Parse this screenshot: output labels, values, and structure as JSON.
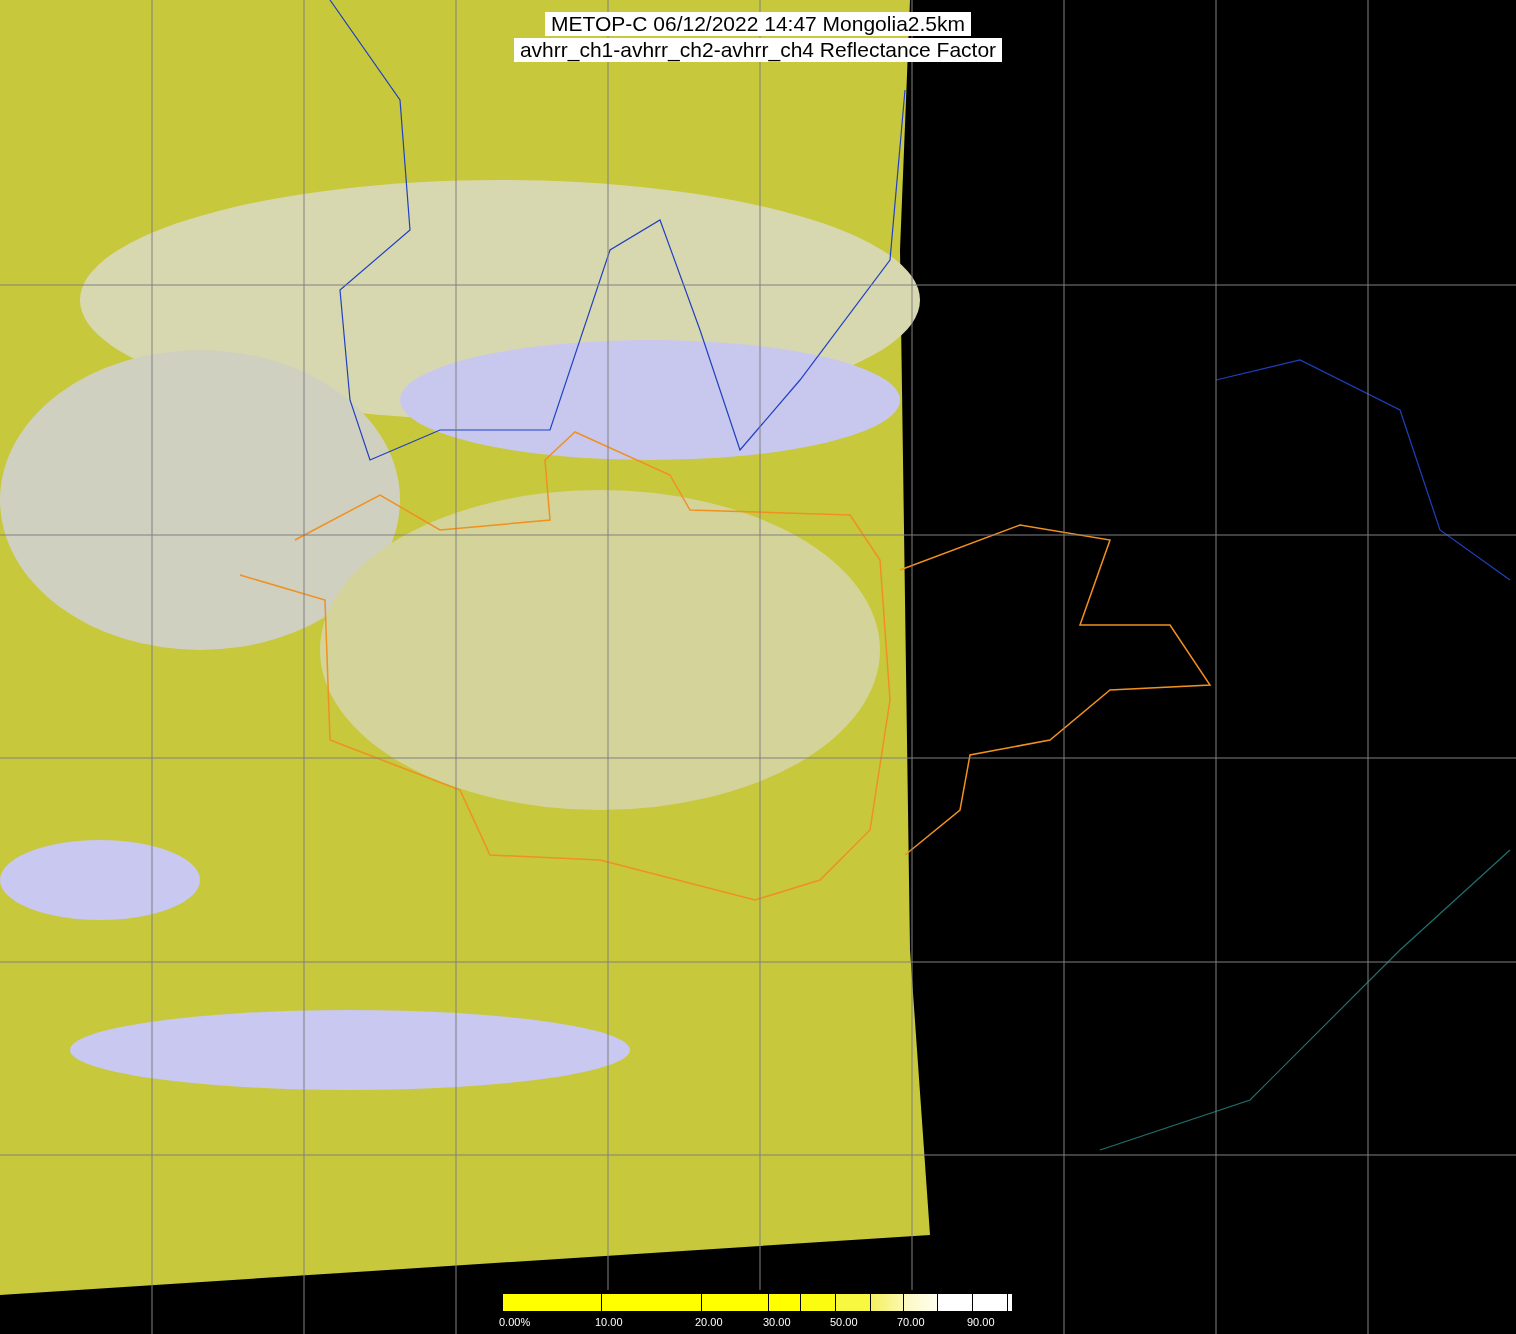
{
  "title": {
    "lines": [
      "METOP-C 06/12/2022 14:47 Mongolia2.5km",
      "avhrr_ch1-avhrr_ch2-avhrr_ch4 Reflectance Factor"
    ]
  },
  "colorbar": {
    "labels": [
      "0.00%",
      "10.00",
      "20.00",
      "30.00",
      "50.00",
      "70.00",
      "90.00"
    ]
  }
}
